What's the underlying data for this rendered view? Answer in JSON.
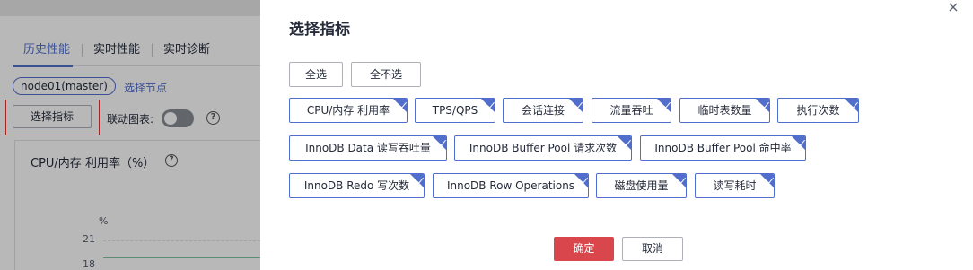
{
  "background": {
    "tabs": [
      "历史性能",
      "实时性能",
      "实时诊断"
    ],
    "node_tag": "node01(master)",
    "select_node_link": "选择节点",
    "metric_button": "选择指标",
    "linked_chart_label": "联动图表:",
    "help_glyph": "?",
    "chart_title": "CPU/内存 利用率（%）",
    "chart_unit": "%",
    "y_ticks": [
      "21",
      "18"
    ]
  },
  "drawer": {
    "title": "选择指标",
    "select_all": "全选",
    "select_none": "全不选",
    "metrics_row1": [
      "CPU/内存 利用率",
      "TPS/QPS",
      "会话连接",
      "流量吞吐",
      "临时表数量",
      "执行次数"
    ],
    "metrics_row2": [
      "InnoDB Data 读写吞吐量",
      "InnoDB Buffer Pool 请求次数",
      "InnoDB Buffer Pool 命中率"
    ],
    "metrics_row3": [
      "InnoDB Redo 写次数",
      "InnoDB Row Operations",
      "磁盘使用量",
      "读写耗时"
    ],
    "ok_label": "确定",
    "cancel_label": "取消"
  },
  "colors": {
    "accent": "#526ecc",
    "primary_button": "#d9464b",
    "highlight_box": "#e03838"
  },
  "icons": {
    "close": "close-icon",
    "help": "help-circle-icon",
    "chip_selected": "check-corner-icon"
  }
}
